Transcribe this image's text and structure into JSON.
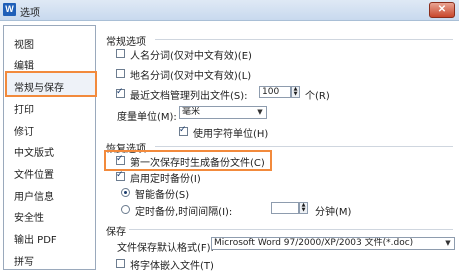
{
  "window": {
    "title": "选项",
    "app_icon": "W",
    "close_glyph": "✕"
  },
  "sidebar": {
    "items": [
      {
        "label": "视图"
      },
      {
        "label": "编辑"
      },
      {
        "label": "常规与保存"
      },
      {
        "label": "打印"
      },
      {
        "label": "修订"
      },
      {
        "label": "中文版式"
      },
      {
        "label": "文件位置"
      },
      {
        "label": "用户信息"
      },
      {
        "label": "安全性"
      },
      {
        "label": "输出 PDF"
      },
      {
        "label": "拼写"
      }
    ]
  },
  "general": {
    "title": "常规选项",
    "name_split_cn": "人名分词(仅对中文有效)(E)",
    "place_split_cn": "地名分词(仅对中文有效)(L)",
    "recent_docs_label": "最近文档管理列出文件(S):",
    "recent_docs_value": "100",
    "recent_docs_unit": "个(R)",
    "unit_label": "度量单位(M):",
    "unit_value": "毫米",
    "use_char_unit": "使用字符单位(H)"
  },
  "recovery": {
    "title": "恢复选项",
    "first_save_backup": "第一次保存时生成备份文件(C)",
    "enable_timed_backup": "启用定时备份(I)",
    "smart_backup": "智能备份(S)",
    "timed_backup_label": "定时备份,时间间隔(I):",
    "interval_value": "",
    "interval_unit": "分钟(M)"
  },
  "save": {
    "title": "保存",
    "default_format_label": "文件保存默认格式(F):",
    "default_format_value": "Microsoft Word 97/2000/XP/2003 文件(*.doc)",
    "embed_fonts": "将字体嵌入文件(T)"
  }
}
